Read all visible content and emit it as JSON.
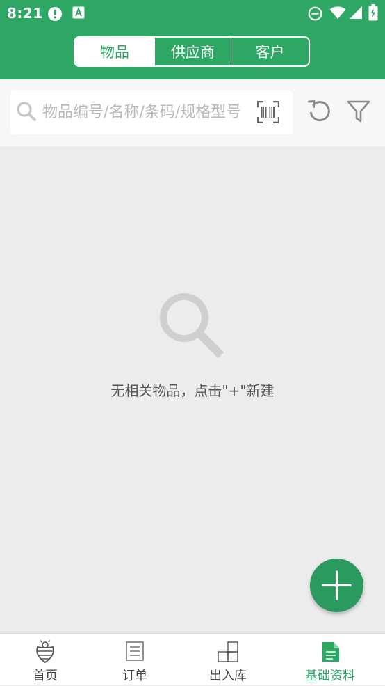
{
  "status_bar": {
    "time": "8:21",
    "icons": [
      "alert-circle-icon",
      "font-a-icon",
      "do-not-disturb-icon",
      "wifi-icon",
      "cellular-signal-icon",
      "battery-charging-icon"
    ]
  },
  "segmented_tabs": [
    {
      "label": "物品",
      "active": true
    },
    {
      "label": "供应商",
      "active": false
    },
    {
      "label": "客户",
      "active": false
    }
  ],
  "search": {
    "placeholder": "物品编号/名称/条码/规格型号",
    "value": ""
  },
  "toolbar": {
    "icons": [
      "scan-barcode-icon",
      "refresh-icon",
      "filter-icon"
    ]
  },
  "empty_state": {
    "icon": "magnifier-icon",
    "message": "无相关物品，点击\"+\"新建"
  },
  "fab": {
    "icon": "plus-icon"
  },
  "bottom_nav": [
    {
      "label": "首页",
      "icon": "home-bee-icon",
      "active": false
    },
    {
      "label": "订单",
      "icon": "order-document-icon",
      "active": false
    },
    {
      "label": "出入库",
      "icon": "warehouse-boxes-icon",
      "active": false
    },
    {
      "label": "基础资料",
      "icon": "basic-data-icon",
      "active": true
    }
  ],
  "colors": {
    "primary": "#2ea765",
    "fab": "#2a9a5e",
    "background": "#ececec",
    "placeholder": "#b9b9b9"
  }
}
